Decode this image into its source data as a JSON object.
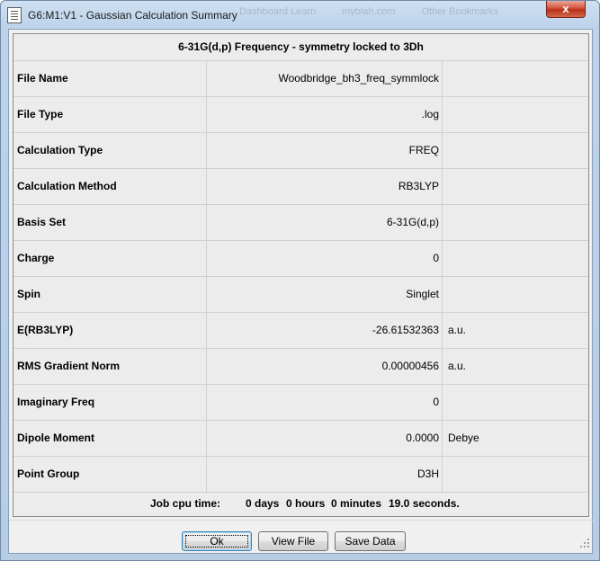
{
  "window": {
    "title": "G6:M1:V1 - Gaussian Calculation Summary",
    "background_tabs": [
      "Dashboard Learn",
      "myblah.com",
      "Other Bookmarks"
    ],
    "close_label": "x"
  },
  "summary": {
    "header": "6-31G(d,p) Frequency - symmetry locked to 3Dh",
    "rows": [
      {
        "label": "File Name",
        "value": "Woodbridge_bh3_freq_symmlock",
        "unit": ""
      },
      {
        "label": "File Type",
        "value": ".log",
        "unit": ""
      },
      {
        "label": "Calculation Type",
        "value": "FREQ",
        "unit": ""
      },
      {
        "label": "Calculation Method",
        "value": "RB3LYP",
        "unit": ""
      },
      {
        "label": "Basis Set",
        "value": "6-31G(d,p)",
        "unit": ""
      },
      {
        "label": "Charge",
        "value": "0",
        "unit": ""
      },
      {
        "label": "Spin",
        "value": "Singlet",
        "unit": ""
      },
      {
        "label": "E(RB3LYP)",
        "value": "-26.61532363",
        "unit": "a.u."
      },
      {
        "label": "RMS Gradient Norm",
        "value": "0.00000456",
        "unit": "a.u."
      },
      {
        "label": "Imaginary Freq",
        "value": "0",
        "unit": ""
      },
      {
        "label": "Dipole Moment",
        "value": "0.0000",
        "unit": "Debye"
      },
      {
        "label": "Point Group",
        "value": "D3H",
        "unit": ""
      }
    ],
    "cpu_time": {
      "label": "Job cpu time:",
      "days": "0 days",
      "hours": "0 hours",
      "minutes": "0 minutes",
      "seconds": "19.0 seconds."
    }
  },
  "buttons": {
    "ok": "Ok",
    "view_file": "View File",
    "save_data": "Save Data"
  },
  "colors": {
    "window_frame": "#bcd3ea",
    "close_button": "#c9452e",
    "panel_background": "#f0f0f0"
  }
}
